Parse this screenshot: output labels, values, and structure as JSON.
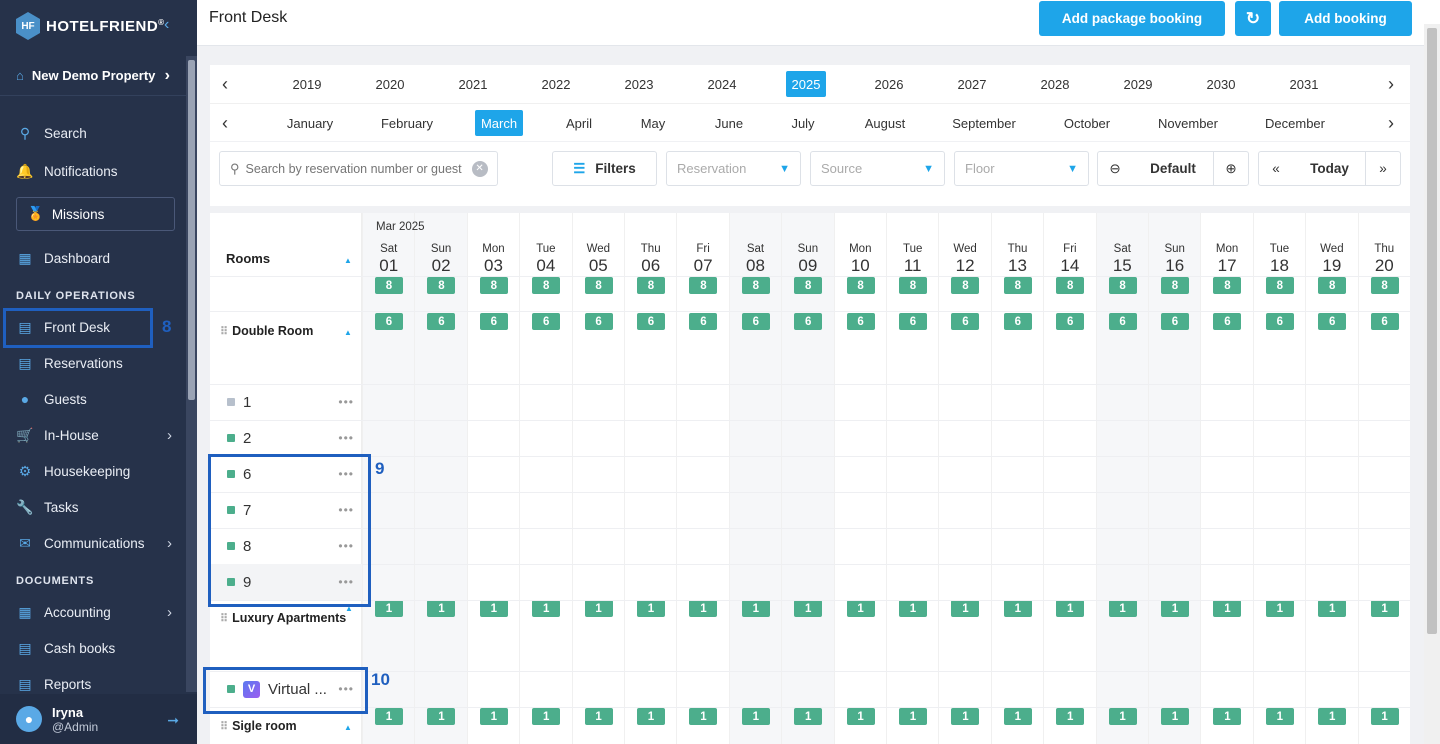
{
  "sidebar": {
    "brand": "HOTELFRIEND",
    "property": "New Demo Property",
    "search": "Search",
    "notifications": "Notifications",
    "missions": "Missions",
    "dashboard": "Dashboard",
    "section_daily": "DAILY OPERATIONS",
    "front_desk": "Front Desk",
    "reservations": "Reservations",
    "guests": "Guests",
    "in_house": "In-House",
    "housekeeping": "Housekeeping",
    "tasks": "Tasks",
    "communications": "Communications",
    "section_documents": "DOCUMENTS",
    "accounting": "Accounting",
    "cash_books": "Cash books",
    "reports": "Reports",
    "user_name": "Iryna",
    "user_role": "@Admin"
  },
  "annotations": {
    "a8": "8",
    "a9": "9",
    "a10": "10"
  },
  "header": {
    "title": "Front Desk",
    "add_package": "Add package booking",
    "add_booking": "Add booking"
  },
  "years": [
    "2019",
    "2020",
    "2021",
    "2022",
    "2023",
    "2024",
    "2025",
    "2026",
    "2027",
    "2028",
    "2029",
    "2030",
    "2031"
  ],
  "active_year": "2025",
  "months": [
    "January",
    "February",
    "March",
    "April",
    "May",
    "June",
    "July",
    "August",
    "September",
    "October",
    "November",
    "December"
  ],
  "active_month": "March",
  "filters": {
    "search_placeholder": "Search by reservation number or guest",
    "filters_label": "Filters",
    "reservation": "Reservation",
    "source": "Source",
    "floor": "Floor",
    "zoom_label": "Default",
    "today": "Today"
  },
  "calendar": {
    "rooms_label": "Rooms",
    "month_label": "Mar 2025",
    "days": [
      {
        "dow": "Sat",
        "num": "01",
        "wk": true
      },
      {
        "dow": "Sun",
        "num": "02",
        "wk": true
      },
      {
        "dow": "Mon",
        "num": "03"
      },
      {
        "dow": "Tue",
        "num": "04"
      },
      {
        "dow": "Wed",
        "num": "05"
      },
      {
        "dow": "Thu",
        "num": "06"
      },
      {
        "dow": "Fri",
        "num": "07"
      },
      {
        "dow": "Sat",
        "num": "08",
        "wk": true
      },
      {
        "dow": "Sun",
        "num": "09",
        "wk": true
      },
      {
        "dow": "Mon",
        "num": "10"
      },
      {
        "dow": "Tue",
        "num": "11"
      },
      {
        "dow": "Wed",
        "num": "12"
      },
      {
        "dow": "Thu",
        "num": "13"
      },
      {
        "dow": "Fri",
        "num": "14"
      },
      {
        "dow": "Sat",
        "num": "15",
        "wk": true
      },
      {
        "dow": "Sun",
        "num": "16",
        "wk": true
      },
      {
        "dow": "Mon",
        "num": "17"
      },
      {
        "dow": "Tue",
        "num": "18"
      },
      {
        "dow": "Wed",
        "num": "19"
      },
      {
        "dow": "Thu",
        "num": "20"
      }
    ],
    "total_avail": "8",
    "categories": [
      {
        "name": "Double Room",
        "avail": "6",
        "rooms": [
          {
            "num": "1",
            "grey": true
          },
          {
            "num": "2"
          },
          {
            "num": "6"
          },
          {
            "num": "7"
          },
          {
            "num": "8"
          },
          {
            "num": "9"
          }
        ]
      },
      {
        "name": "Luxury Apartments",
        "avail": "1",
        "rooms": [
          {
            "num": "Virtual ...",
            "virtual": true,
            "badge": "V"
          }
        ]
      },
      {
        "name": "Sigle room",
        "avail": "1",
        "rooms": []
      }
    ]
  }
}
